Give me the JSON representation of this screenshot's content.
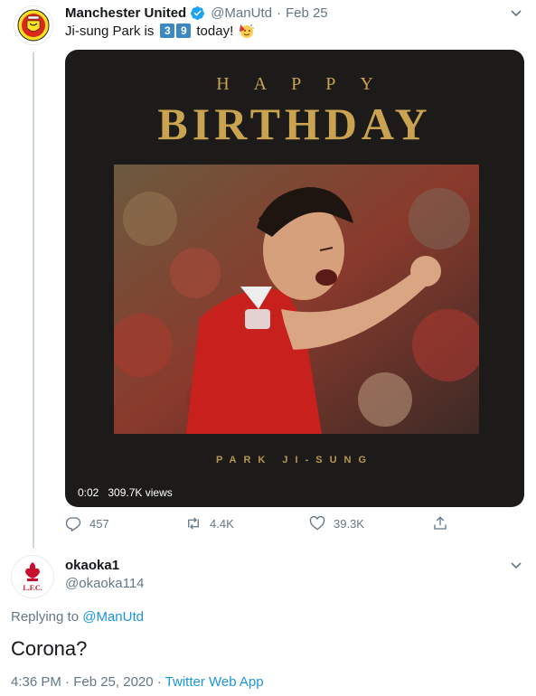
{
  "tweet": {
    "author_name": "Manchester United",
    "handle": "@ManUtd",
    "separator": "·",
    "date": "Feb 25",
    "text_prefix": "Ji-sung Park is",
    "age_digit_1": "3",
    "age_digit_2": "9",
    "text_suffix": "today!",
    "avatar_icon": "manutd-crest-icon",
    "verified_icon": "verified-badge-icon",
    "media": {
      "heading_small": "HAPPY",
      "heading_large": "BIRTHDAY",
      "player_caption": "PARK JI-SUNG",
      "video_time": "0:02",
      "views": "309.7K views"
    },
    "actions": {
      "replies": "457",
      "retweets": "4.4K",
      "likes": "39.3K"
    }
  },
  "reply": {
    "author_name": "okaoka1",
    "handle": "@okaoka114",
    "avatar_icon": "liverpool-crest-icon",
    "replying_prefix": "Replying to",
    "replying_to": "@ManUtd",
    "text": "Corona?",
    "timestamp": "4:36 PM · Feb 25, 2020 ·",
    "source_app": "Twitter Web App"
  },
  "colors": {
    "link": "#1b95e0",
    "secondary_text": "#657786",
    "gold": "#c9a34f",
    "media_bg": "#1c1b1a"
  }
}
